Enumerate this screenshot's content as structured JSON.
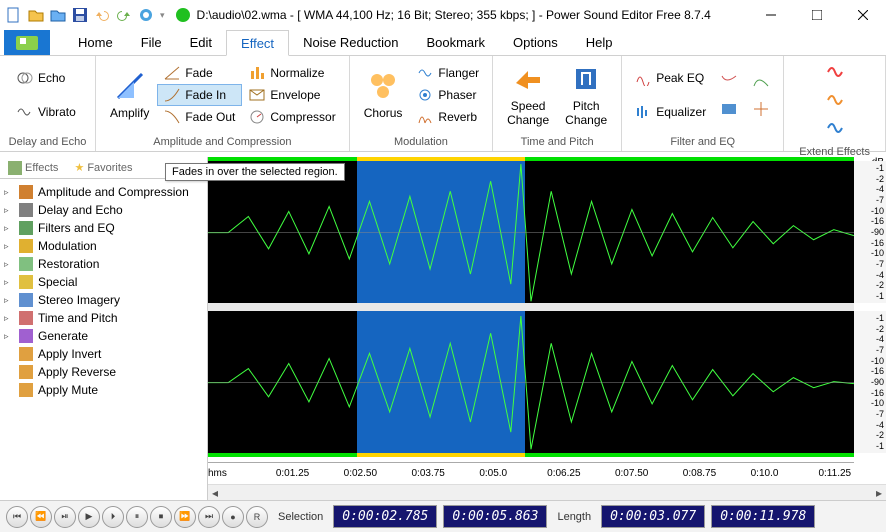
{
  "title": "D:\\audio\\02.wma - [ WMA 44,100 Hz; 16 Bit; Stereo; 355 kbps; ] - Power Sound Editor Free 8.7.4",
  "tabs": [
    "Home",
    "File",
    "Edit",
    "Effect",
    "Noise Reduction",
    "Bookmark",
    "Options",
    "Help"
  ],
  "active_tab": "Effect",
  "ribbon": {
    "group1": {
      "label": "Delay and Echo",
      "items": [
        "Echo",
        "Vibrato"
      ]
    },
    "group2": {
      "label": "Amplitude and Compression",
      "big": "Amplify",
      "col1": [
        "Fade",
        "Fade In",
        "Fade Out"
      ],
      "col2": [
        "Normalize",
        "Envelope",
        "Compressor"
      ]
    },
    "group3": {
      "label": "Modulation",
      "big": "Chorus",
      "col1": [
        "Flanger",
        "Phaser",
        "Reverb"
      ]
    },
    "group4": {
      "label": "Time and Pitch",
      "big1": "Speed\nChange",
      "big2": "Pitch\nChange"
    },
    "group5": {
      "label": "Filter and EQ",
      "col1": [
        "Peak EQ",
        "Equalizer"
      ]
    },
    "group6": {
      "label": "Extend Effects"
    }
  },
  "tooltip": "Fades in over the selected region.",
  "sidetabs": [
    "Effects",
    "Favorites"
  ],
  "tree": [
    "Amplitude and Compression",
    "Delay and Echo",
    "Filters and EQ",
    "Modulation",
    "Restoration",
    "Special",
    "Stereo Imagery",
    "Time and Pitch",
    "Generate",
    "Apply Invert",
    "Apply Reverse",
    "Apply Mute"
  ],
  "db_marks": [
    "-1",
    "-2",
    "-4",
    "-7",
    "-10",
    "-16",
    "-90",
    "-16",
    "-10",
    "-7",
    "-4",
    "-2",
    "-1"
  ],
  "db_header": "dB",
  "time_marks": [
    "hms",
    "0:01.25",
    "0:02.50",
    "0:03.75",
    "0:05.0",
    "0:06.25",
    "0:07.50",
    "0:08.75",
    "0:10.0",
    "0:11.25"
  ],
  "status": {
    "selection_label": "Selection",
    "selection_start": "0:00:02.785",
    "selection_end": "0:00:05.863",
    "length_label": "Length",
    "length_val": "0:00:03.077",
    "total": "0:00:11.978"
  },
  "transport": [
    "⏮",
    "⏪",
    "⏯",
    "▶",
    "⏵",
    "⏸",
    "⏹",
    "⏩",
    "⏭",
    "●",
    "R"
  ]
}
